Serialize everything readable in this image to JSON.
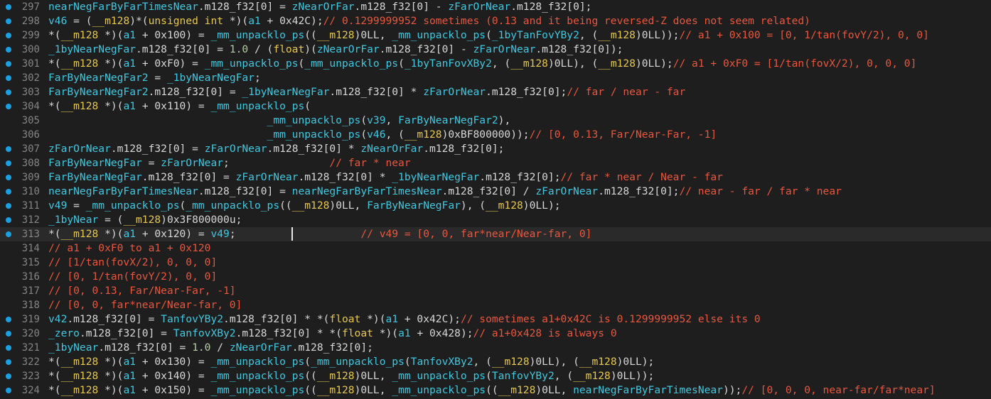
{
  "colors": {
    "background": "#1e1e1e",
    "current_line": "#2a2a2a",
    "breakpoint_dot": "#1ba1e2",
    "line_number": "#858585",
    "plain": "#d8d8d8",
    "identifier": "#40c8e0",
    "type": "#e6c84f",
    "comment": "#e8573e",
    "number": "#b5cea8"
  },
  "lines": [
    {
      "num": "297",
      "bp": true,
      "tokens": [
        [
          "id",
          "nearNegFarByFarTimesNear"
        ],
        [
          "pl",
          ".m128_f32[0] = "
        ],
        [
          "id",
          "zNearOrFar"
        ],
        [
          "pl",
          ".m128_f32[0] - "
        ],
        [
          "id",
          "zFarOrNear"
        ],
        [
          "pl",
          ".m128_f32[0];"
        ]
      ]
    },
    {
      "num": "298",
      "bp": true,
      "tokens": [
        [
          "id",
          "v46"
        ],
        [
          "pl",
          " = ("
        ],
        [
          "ty",
          "__m128"
        ],
        [
          "pl",
          ")*("
        ],
        [
          "ty",
          "unsigned int"
        ],
        [
          "pl",
          " *)("
        ],
        [
          "id",
          "a1"
        ],
        [
          "pl",
          " + 0x42C);"
        ],
        [
          "cm",
          "// 0.1299999952 sometimes (0.13 and it being reversed-Z does not seem related)"
        ]
      ]
    },
    {
      "num": "299",
      "bp": true,
      "tokens": [
        [
          "pl",
          "*("
        ],
        [
          "ty",
          "__m128"
        ],
        [
          "pl",
          " *)("
        ],
        [
          "id",
          "a1"
        ],
        [
          "pl",
          " + 0x100) = "
        ],
        [
          "id",
          "_mm_unpacklo_ps"
        ],
        [
          "pl",
          "(("
        ],
        [
          "ty",
          "__m128"
        ],
        [
          "pl",
          ")0LL, "
        ],
        [
          "id",
          "_mm_unpacklo_ps"
        ],
        [
          "pl",
          "("
        ],
        [
          "id",
          "_1byTanFovYBy2"
        ],
        [
          "pl",
          ", ("
        ],
        [
          "ty",
          "__m128"
        ],
        [
          "pl",
          ")0LL));"
        ],
        [
          "cm",
          "// a1 + 0x100 = [0, 1/tan(fovY/2), 0, 0]"
        ]
      ]
    },
    {
      "num": "300",
      "bp": true,
      "tokens": [
        [
          "id",
          "_1byNearNegFar"
        ],
        [
          "pl",
          ".m128_f32[0] = "
        ],
        [
          "nu",
          "1.0"
        ],
        [
          "pl",
          " / ("
        ],
        [
          "ty",
          "float"
        ],
        [
          "pl",
          ")("
        ],
        [
          "id",
          "zNearOrFar"
        ],
        [
          "pl",
          ".m128_f32[0] - "
        ],
        [
          "id",
          "zFarOrNear"
        ],
        [
          "pl",
          ".m128_f32[0]);"
        ]
      ]
    },
    {
      "num": "301",
      "bp": true,
      "tokens": [
        [
          "pl",
          "*("
        ],
        [
          "ty",
          "__m128"
        ],
        [
          "pl",
          " *)("
        ],
        [
          "id",
          "a1"
        ],
        [
          "pl",
          " + 0xF0) = "
        ],
        [
          "id",
          "_mm_unpacklo_ps"
        ],
        [
          "pl",
          "("
        ],
        [
          "id",
          "_mm_unpacklo_ps"
        ],
        [
          "pl",
          "("
        ],
        [
          "id",
          "_1byTanFovXBy2"
        ],
        [
          "pl",
          ", ("
        ],
        [
          "ty",
          "__m128"
        ],
        [
          "pl",
          ")0LL), ("
        ],
        [
          "ty",
          "__m128"
        ],
        [
          "pl",
          ")0LL);"
        ],
        [
          "cm",
          "// a1 + 0xF0 = [1/tan(fovX/2), 0, 0, 0]"
        ]
      ]
    },
    {
      "num": "302",
      "bp": true,
      "tokens": [
        [
          "id",
          "FarByNearNegFar2"
        ],
        [
          "pl",
          " = "
        ],
        [
          "id",
          "_1byNearNegFar"
        ],
        [
          "pl",
          ";"
        ]
      ]
    },
    {
      "num": "303",
      "bp": true,
      "tokens": [
        [
          "id",
          "FarByNearNegFar2"
        ],
        [
          "pl",
          ".m128_f32[0] = "
        ],
        [
          "id",
          "_1byNearNegFar"
        ],
        [
          "pl",
          ".m128_f32[0] * "
        ],
        [
          "id",
          "zFarOrNear"
        ],
        [
          "pl",
          ".m128_f32[0];"
        ],
        [
          "cm",
          "// far / near - far"
        ]
      ]
    },
    {
      "num": "304",
      "bp": true,
      "tokens": [
        [
          "pl",
          "*("
        ],
        [
          "ty",
          "__m128"
        ],
        [
          "pl",
          " *)("
        ],
        [
          "id",
          "a1"
        ],
        [
          "pl",
          " + 0x110) = "
        ],
        [
          "id",
          "_mm_unpacklo_ps"
        ],
        [
          "pl",
          "("
        ]
      ]
    },
    {
      "num": "305",
      "bp": false,
      "tokens": [
        [
          "pl",
          "                                   "
        ],
        [
          "id",
          "_mm_unpacklo_ps"
        ],
        [
          "pl",
          "("
        ],
        [
          "id",
          "v39"
        ],
        [
          "pl",
          ", "
        ],
        [
          "id",
          "FarByNearNegFar2"
        ],
        [
          "pl",
          "),"
        ]
      ]
    },
    {
      "num": "306",
      "bp": false,
      "tokens": [
        [
          "pl",
          "                                   "
        ],
        [
          "id",
          "_mm_unpacklo_ps"
        ],
        [
          "pl",
          "("
        ],
        [
          "id",
          "v46"
        ],
        [
          "pl",
          ", ("
        ],
        [
          "ty",
          "__m128"
        ],
        [
          "pl",
          ")0xBF800000));"
        ],
        [
          "cm",
          "// [0, 0.13, Far/Near-Far, -1]"
        ]
      ]
    },
    {
      "num": "307",
      "bp": true,
      "tokens": [
        [
          "id",
          "zFarOrNear"
        ],
        [
          "pl",
          ".m128_f32[0] = "
        ],
        [
          "id",
          "zFarOrNear"
        ],
        [
          "pl",
          ".m128_f32[0] * "
        ],
        [
          "id",
          "zNearOrFar"
        ],
        [
          "pl",
          ".m128_f32[0];"
        ]
      ]
    },
    {
      "num": "308",
      "bp": true,
      "tokens": [
        [
          "id",
          "FarByNearNegFar"
        ],
        [
          "pl",
          " = "
        ],
        [
          "id",
          "zFarOrNear"
        ],
        [
          "pl",
          ";                "
        ],
        [
          "cm",
          "// far * near"
        ]
      ]
    },
    {
      "num": "309",
      "bp": true,
      "tokens": [
        [
          "id",
          "FarByNearNegFar"
        ],
        [
          "pl",
          ".m128_f32[0] = "
        ],
        [
          "id",
          "zFarOrNear"
        ],
        [
          "pl",
          ".m128_f32[0] * "
        ],
        [
          "id",
          "_1byNearNegFar"
        ],
        [
          "pl",
          ".m128_f32[0];"
        ],
        [
          "cm",
          "// far * near / Near - far"
        ]
      ]
    },
    {
      "num": "310",
      "bp": true,
      "tokens": [
        [
          "id",
          "nearNegFarByFarTimesNear"
        ],
        [
          "pl",
          ".m128_f32[0] = "
        ],
        [
          "id",
          "nearNegFarByFarTimesNear"
        ],
        [
          "pl",
          ".m128_f32[0] / "
        ],
        [
          "id",
          "zFarOrNear"
        ],
        [
          "pl",
          ".m128_f32[0];"
        ],
        [
          "cm",
          "// near - far / far * near"
        ]
      ]
    },
    {
      "num": "311",
      "bp": true,
      "tokens": [
        [
          "id",
          "v49"
        ],
        [
          "pl",
          " = "
        ],
        [
          "id",
          "_mm_unpacklo_ps"
        ],
        [
          "pl",
          "("
        ],
        [
          "id",
          "_mm_unpacklo_ps"
        ],
        [
          "pl",
          "(("
        ],
        [
          "ty",
          "__m128"
        ],
        [
          "pl",
          ")0LL, "
        ],
        [
          "id",
          "FarByNearNegFar"
        ],
        [
          "pl",
          "), ("
        ],
        [
          "ty",
          "__m128"
        ],
        [
          "pl",
          ")0LL);"
        ]
      ]
    },
    {
      "num": "312",
      "bp": true,
      "tokens": [
        [
          "id",
          "_1byNear"
        ],
        [
          "pl",
          " = ("
        ],
        [
          "ty",
          "__m128"
        ],
        [
          "pl",
          ")0x3F800000u;"
        ]
      ]
    },
    {
      "num": "313",
      "bp": true,
      "current": true,
      "tokens": [
        [
          "pl",
          "*("
        ],
        [
          "ty",
          "__m128"
        ],
        [
          "pl",
          " *)("
        ],
        [
          "id",
          "a1"
        ],
        [
          "pl",
          " + 0x120) = "
        ],
        [
          "id",
          "v49"
        ],
        [
          "pl",
          ";                    "
        ],
        [
          "cm",
          "// v49 = [0, 0, far*near/Near-far, 0]"
        ]
      ]
    },
    {
      "num": "314",
      "bp": false,
      "tokens": [
        [
          "cm",
          "// a1 + 0xF0 to a1 + 0x120"
        ]
      ]
    },
    {
      "num": "315",
      "bp": false,
      "tokens": [
        [
          "cm",
          "// [1/tan(fovX/2), 0, 0, 0]"
        ]
      ]
    },
    {
      "num": "316",
      "bp": false,
      "tokens": [
        [
          "cm",
          "// [0, 1/tan(fovY/2), 0, 0]"
        ]
      ]
    },
    {
      "num": "317",
      "bp": false,
      "tokens": [
        [
          "cm",
          "// [0, 0.13, Far/Near-Far, -1]"
        ]
      ]
    },
    {
      "num": "318",
      "bp": false,
      "tokens": [
        [
          "cm",
          "// [0, 0, far*near/Near-far, 0]"
        ]
      ]
    },
    {
      "num": "319",
      "bp": true,
      "tokens": [
        [
          "id",
          "v42"
        ],
        [
          "pl",
          ".m128_f32[0] = "
        ],
        [
          "id",
          "TanfovYBy2"
        ],
        [
          "pl",
          ".m128_f32[0] * *("
        ],
        [
          "ty",
          "float"
        ],
        [
          "pl",
          " *)("
        ],
        [
          "id",
          "a1"
        ],
        [
          "pl",
          " + 0x42C);"
        ],
        [
          "cm",
          "// sometimes a1+0x42C is 0.1299999952 else its 0"
        ]
      ]
    },
    {
      "num": "320",
      "bp": true,
      "tokens": [
        [
          "id",
          "_zero"
        ],
        [
          "pl",
          ".m128_f32[0] = "
        ],
        [
          "id",
          "TanfovXBy2"
        ],
        [
          "pl",
          ".m128_f32[0] * *("
        ],
        [
          "ty",
          "float"
        ],
        [
          "pl",
          " *)("
        ],
        [
          "id",
          "a1"
        ],
        [
          "pl",
          " + 0x428);"
        ],
        [
          "cm",
          "// a1+0x428 is always 0"
        ]
      ]
    },
    {
      "num": "321",
      "bp": true,
      "tokens": [
        [
          "id",
          "_1byNear"
        ],
        [
          "pl",
          ".m128_f32[0] = "
        ],
        [
          "nu",
          "1.0"
        ],
        [
          "pl",
          " / "
        ],
        [
          "id",
          "zNearOrFar"
        ],
        [
          "pl",
          ".m128_f32[0];"
        ]
      ]
    },
    {
      "num": "322",
      "bp": true,
      "tokens": [
        [
          "pl",
          "*("
        ],
        [
          "ty",
          "__m128"
        ],
        [
          "pl",
          " *)("
        ],
        [
          "id",
          "a1"
        ],
        [
          "pl",
          " + 0x130) = "
        ],
        [
          "id",
          "_mm_unpacklo_ps"
        ],
        [
          "pl",
          "("
        ],
        [
          "id",
          "_mm_unpacklo_ps"
        ],
        [
          "pl",
          "("
        ],
        [
          "id",
          "TanfovXBy2"
        ],
        [
          "pl",
          ", ("
        ],
        [
          "ty",
          "__m128"
        ],
        [
          "pl",
          ")0LL), ("
        ],
        [
          "ty",
          "__m128"
        ],
        [
          "pl",
          ")0LL);"
        ]
      ]
    },
    {
      "num": "323",
      "bp": true,
      "tokens": [
        [
          "pl",
          "*("
        ],
        [
          "ty",
          "__m128"
        ],
        [
          "pl",
          " *)("
        ],
        [
          "id",
          "a1"
        ],
        [
          "pl",
          " + 0x140) = "
        ],
        [
          "id",
          "_mm_unpacklo_ps"
        ],
        [
          "pl",
          "(("
        ],
        [
          "ty",
          "__m128"
        ],
        [
          "pl",
          ")0LL, "
        ],
        [
          "id",
          "_mm_unpacklo_ps"
        ],
        [
          "pl",
          "("
        ],
        [
          "id",
          "TanfovYBy2"
        ],
        [
          "pl",
          ", ("
        ],
        [
          "ty",
          "__m128"
        ],
        [
          "pl",
          ")0LL));"
        ]
      ]
    },
    {
      "num": "324",
      "bp": true,
      "tokens": [
        [
          "pl",
          "*("
        ],
        [
          "ty",
          "__m128"
        ],
        [
          "pl",
          " *)("
        ],
        [
          "id",
          "a1"
        ],
        [
          "pl",
          " + 0x150) = "
        ],
        [
          "id",
          "_mm_unpacklo_ps"
        ],
        [
          "pl",
          "(("
        ],
        [
          "ty",
          "__m128"
        ],
        [
          "pl",
          ")0LL, "
        ],
        [
          "id",
          "_mm_unpacklo_ps"
        ],
        [
          "pl",
          "(("
        ],
        [
          "ty",
          "__m128"
        ],
        [
          "pl",
          ")0LL, "
        ],
        [
          "id",
          "nearNegFarByFarTimesNear"
        ],
        [
          "pl",
          "));"
        ],
        [
          "cm",
          "// [0, 0, 0, near-far/far*near]"
        ]
      ]
    }
  ]
}
